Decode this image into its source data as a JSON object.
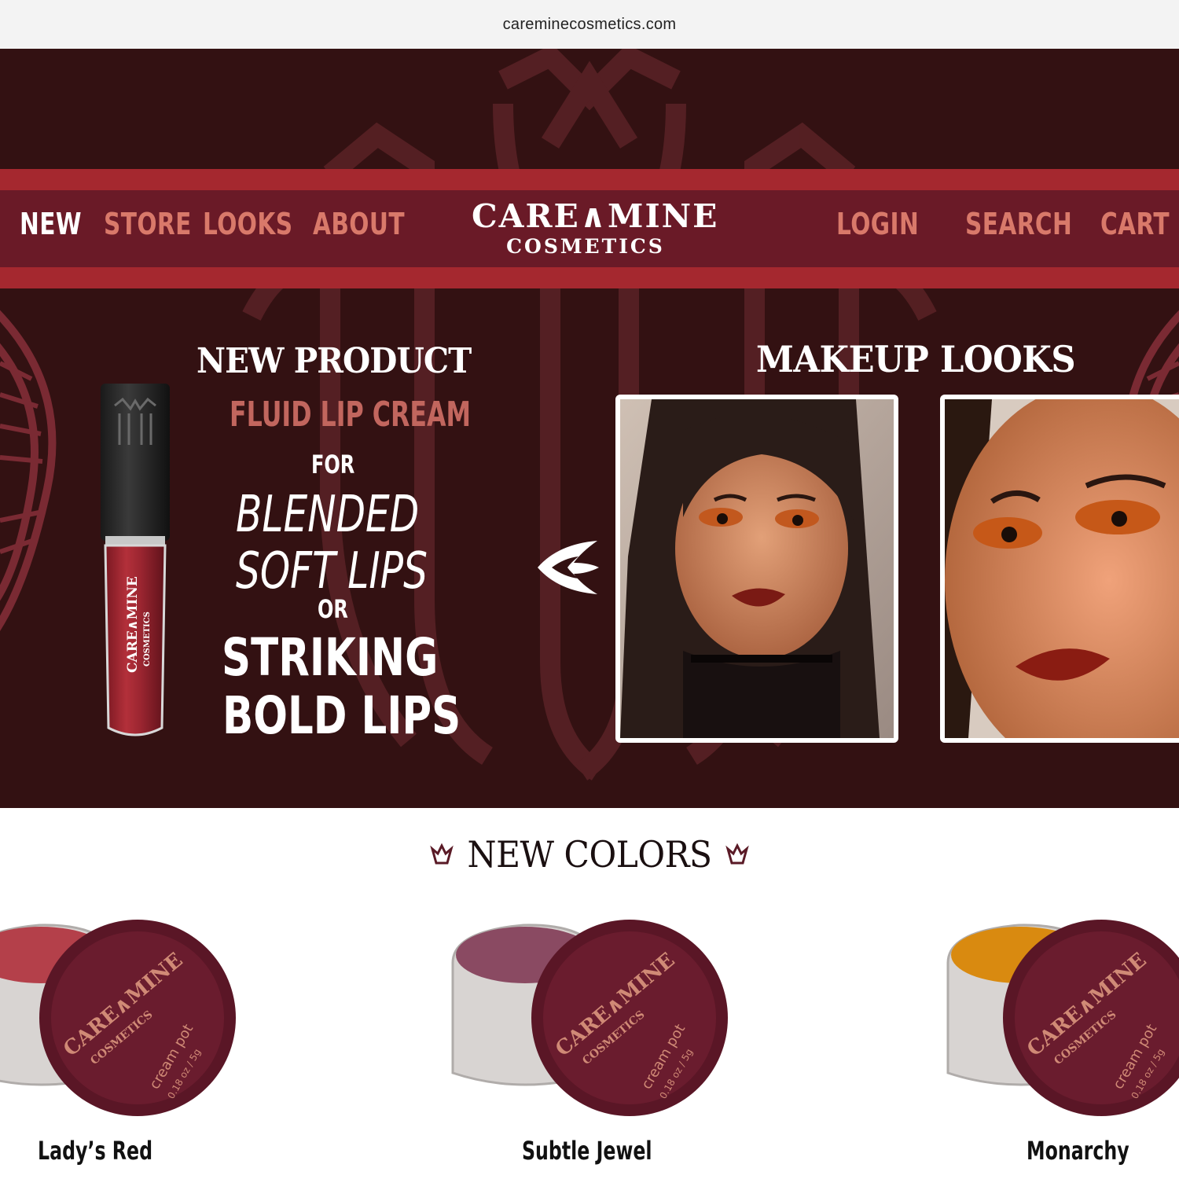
{
  "browser": {
    "url": "careminecosmetics.com"
  },
  "colors": {
    "hero_bg": "#331112",
    "band": "#a5282f",
    "nav_bg": "#6a1a27",
    "accent": "#d9796a",
    "text_light": "#ffffff"
  },
  "nav": {
    "left": [
      "NEW",
      "STORE",
      "LOOKS",
      "ABOUT"
    ],
    "right": [
      "LOGIN",
      "SEARCH",
      "CART"
    ],
    "active": "NEW"
  },
  "logo": {
    "line1": "CARE∧MINE",
    "line2": "COSMETICS"
  },
  "hero": {
    "product_heading": "NEW PRODUCT",
    "product_name": "FLUID LIP CREAM",
    "copy": {
      "for": "FOR",
      "line1": "BLENDED",
      "line2": "SOFT LIPS",
      "or": "OR",
      "line3": "STRIKING",
      "line4": "BOLD LIPS"
    },
    "tube_brand": {
      "line1": "CARE∧MINE",
      "line2": "COSMETICS"
    },
    "looks_heading": "MAKEUP LOOKS"
  },
  "icons": {
    "carousel_prev": "swoosh-arrow-left-icon",
    "crown": "crown-icon"
  },
  "new_colors": {
    "title": "NEW COLORS",
    "products": [
      {
        "name": "Lady’s Red",
        "color": "#b4404a",
        "lid_text": "CARE∧MINE",
        "lid_sub": "COSMETICS",
        "lid_kind": "cream pot",
        "lid_size": "0.18 oz / 5g"
      },
      {
        "name": "Subtle Jewel",
        "color": "#8a4a62",
        "lid_text": "CARE∧MINE",
        "lid_sub": "COSMETICS",
        "lid_kind": "cream pot",
        "lid_size": "0.18 oz / 5g"
      },
      {
        "name": "Monarchy",
        "color": "#d98a10",
        "lid_text": "CARE∧MINE",
        "lid_sub": "COSMETICS",
        "lid_kind": "cream pot",
        "lid_size": "0.18 oz / 5g"
      }
    ]
  }
}
